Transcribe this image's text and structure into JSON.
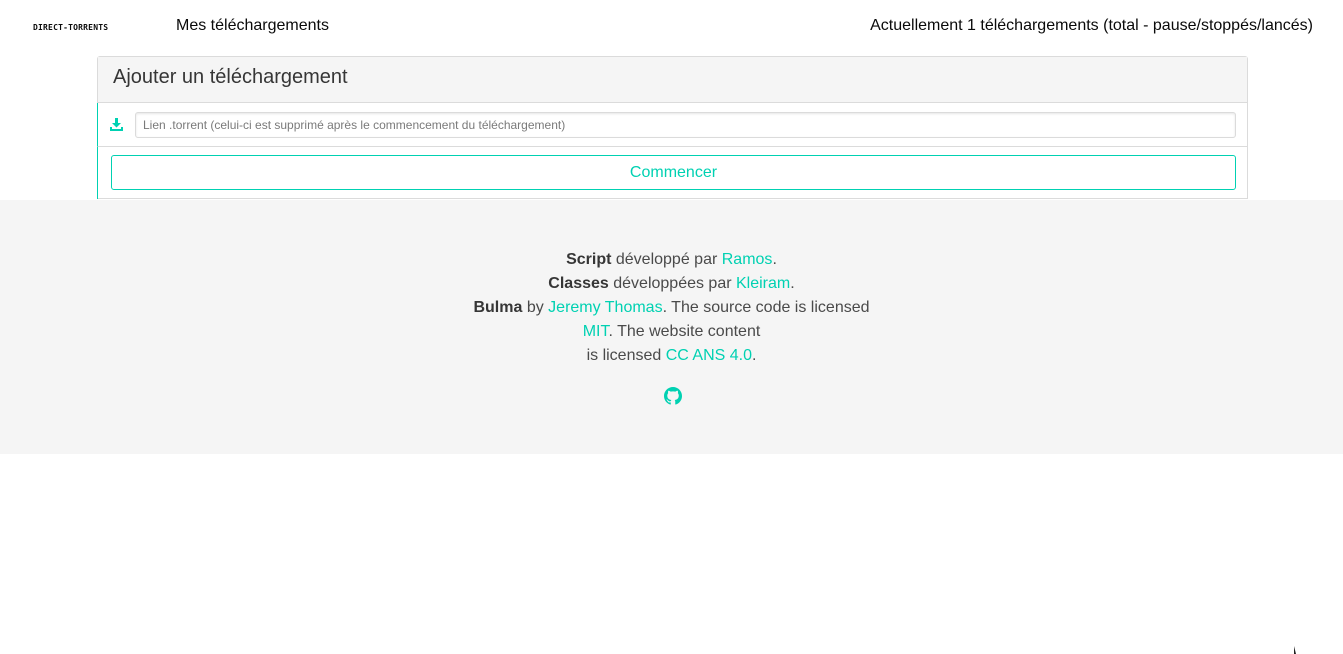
{
  "navbar": {
    "brand": "DIRECT-TORRENTS",
    "downloads_link": "Mes téléchargements",
    "status": "Actuellement 1 téléchargements (total - pause/stoppés/lancés)"
  },
  "panel": {
    "heading": "Ajouter un téléchargement",
    "input_placeholder": "Lien .torrent (celui-ci est supprimé après le commencement du téléchargement)",
    "input_value": "",
    "start_button": "Commencer"
  },
  "footer": {
    "line1": {
      "strong": "Script",
      "text": " développé par ",
      "link": "Ramos",
      "end": "."
    },
    "line2": {
      "strong": "Classes",
      "text": " développées par ",
      "link": "Kleiram",
      "end": "."
    },
    "line3": {
      "strong": "Bulma",
      "text": " by ",
      "link": "Jeremy Thomas",
      "end": ". The source code is licensed"
    },
    "line4": {
      "link": "MIT",
      "end": ". The website content"
    },
    "line5": {
      "text": "is licensed ",
      "link": "CC ANS 4.0",
      "end": "."
    },
    "icon": "github-icon"
  },
  "colors": {
    "accent": "#00d1b2",
    "footer_bg": "#f5f5f5",
    "heading_bg": "#f5f5f5"
  }
}
